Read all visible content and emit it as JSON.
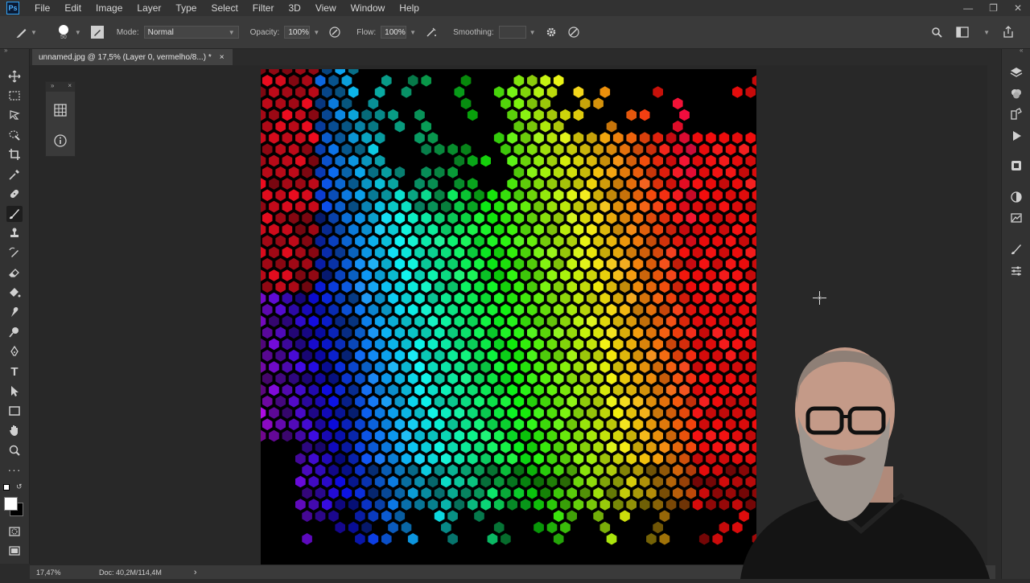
{
  "app": {
    "logo_text": "Ps"
  },
  "menu": [
    "File",
    "Edit",
    "Image",
    "Layer",
    "Type",
    "Select",
    "Filter",
    "3D",
    "View",
    "Window",
    "Help"
  ],
  "options_bar": {
    "brush_size": "50",
    "mode_label": "Mode:",
    "mode_value": "Normal",
    "opacity_label": "Opacity:",
    "opacity_value": "100%",
    "flow_label": "Flow:",
    "flow_value": "100%",
    "smoothing_label": "Smoothing:",
    "smoothing_value": ""
  },
  "document": {
    "tab_title": "unnamed.jpg @ 17,5% (Layer 0, vermelho/8...) *",
    "close_glyph": "×"
  },
  "status": {
    "zoom": "17,47%",
    "doc_info": "Doc: 40,2M/114,4M",
    "arrow": "›"
  },
  "colors": {
    "accent": "#2fa3f7",
    "workspace": "#282828",
    "panel": "#323232",
    "canvas": "#000000"
  },
  "icons": {
    "toolbar": [
      "move-icon",
      "marquee-icon",
      "lasso-icon",
      "quick-select-icon",
      "crop-icon",
      "eyedropper-icon",
      "healing-icon",
      "brush-icon",
      "stamp-icon",
      "history-brush-icon",
      "eraser-icon",
      "paint-bucket-icon",
      "smudge-icon",
      "dodge-icon",
      "pen-icon",
      "type-icon",
      "path-select-icon",
      "rectangle-icon",
      "hand-icon",
      "zoom-icon",
      "more-icon"
    ],
    "right_dock": [
      "layers-icon",
      "channels-icon",
      "paths-icon",
      "play-icon",
      "libraries-icon",
      "adjustments-icon",
      "styles-icon",
      "brushes-icon",
      "properties-icon"
    ]
  }
}
